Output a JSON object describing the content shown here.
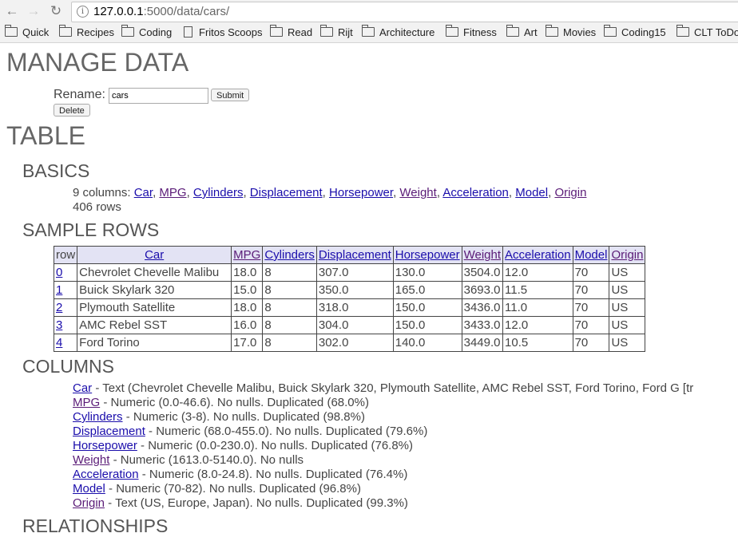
{
  "browser": {
    "url_host": "127.0.0.1",
    "url_rest": ":5000/data/cars/",
    "bookmarks": [
      "Quick",
      "Recipes",
      "Coding",
      "Fritos Scoops",
      "Read",
      "Rijt",
      "Architecture",
      "Fitness",
      "Art",
      "Movies",
      "Coding15",
      "CLT ToDo"
    ]
  },
  "page": {
    "manage_title": "MANAGE DATA",
    "rename_label": "Rename:",
    "rename_value": "cars",
    "submit_label": "Submit",
    "delete_label": "Delete",
    "table_title": "TABLE",
    "basics_title": "BASICS",
    "columns_prefix": "9 columns:",
    "column_links": [
      "Car",
      "MPG",
      "Cylinders",
      "Displacement",
      "Horsepower",
      "Weight",
      "Acceleration",
      "Model",
      "Origin"
    ],
    "rows_count": "406 rows",
    "sample_title": "SAMPLE ROWS",
    "columns_title": "COLUMNS",
    "relationships_title": "RELATIONSHIPS"
  },
  "sample_table": {
    "headers": [
      "row",
      "Car",
      "MPG",
      "Cylinders",
      "Displacement",
      "Horsepower",
      "Weight",
      "Acceleration",
      "Model",
      "Origin"
    ],
    "rows": [
      [
        "0",
        "Chevrolet Chevelle Malibu",
        "18.0",
        "8",
        "307.0",
        "130.0",
        "3504.0",
        "12.0",
        "70",
        "US"
      ],
      [
        "1",
        "Buick Skylark 320",
        "15.0",
        "8",
        "350.0",
        "165.0",
        "3693.0",
        "11.5",
        "70",
        "US"
      ],
      [
        "2",
        "Plymouth Satellite",
        "18.0",
        "8",
        "318.0",
        "150.0",
        "3436.0",
        "11.0",
        "70",
        "US"
      ],
      [
        "3",
        "AMC Rebel SST",
        "16.0",
        "8",
        "304.0",
        "150.0",
        "3433.0",
        "12.0",
        "70",
        "US"
      ],
      [
        "4",
        "Ford Torino",
        "17.0",
        "8",
        "302.0",
        "140.0",
        "3449.0",
        "10.5",
        "70",
        "US"
      ]
    ]
  },
  "column_details": [
    {
      "name": "Car",
      "desc": " - Text (Chevrolet Chevelle Malibu, Buick Skylark 320, Plymouth Satellite, AMC Rebel SST, Ford Torino, Ford G [tr"
    },
    {
      "name": "MPG",
      "desc": " - Numeric (0.0-46.6). No nulls. Duplicated (68.0%)"
    },
    {
      "name": "Cylinders",
      "desc": " - Numeric (3-8). No nulls. Duplicated (98.8%)"
    },
    {
      "name": "Displacement",
      "desc": " - Numeric (68.0-455.0). No nulls. Duplicated (79.6%)"
    },
    {
      "name": "Horsepower",
      "desc": " - Numeric (0.0-230.0). No nulls. Duplicated (76.8%)"
    },
    {
      "name": "Weight",
      "desc": " - Numeric (1613.0-5140.0). No nulls"
    },
    {
      "name": "Acceleration",
      "desc": " - Numeric (8.0-24.8). No nulls. Duplicated (76.4%)"
    },
    {
      "name": "Model",
      "desc": " - Numeric (70-82). No nulls. Duplicated (96.8%)"
    },
    {
      "name": "Origin",
      "desc": " - Text (US, Europe, Japan). No nulls. Duplicated (99.3%)"
    }
  ]
}
